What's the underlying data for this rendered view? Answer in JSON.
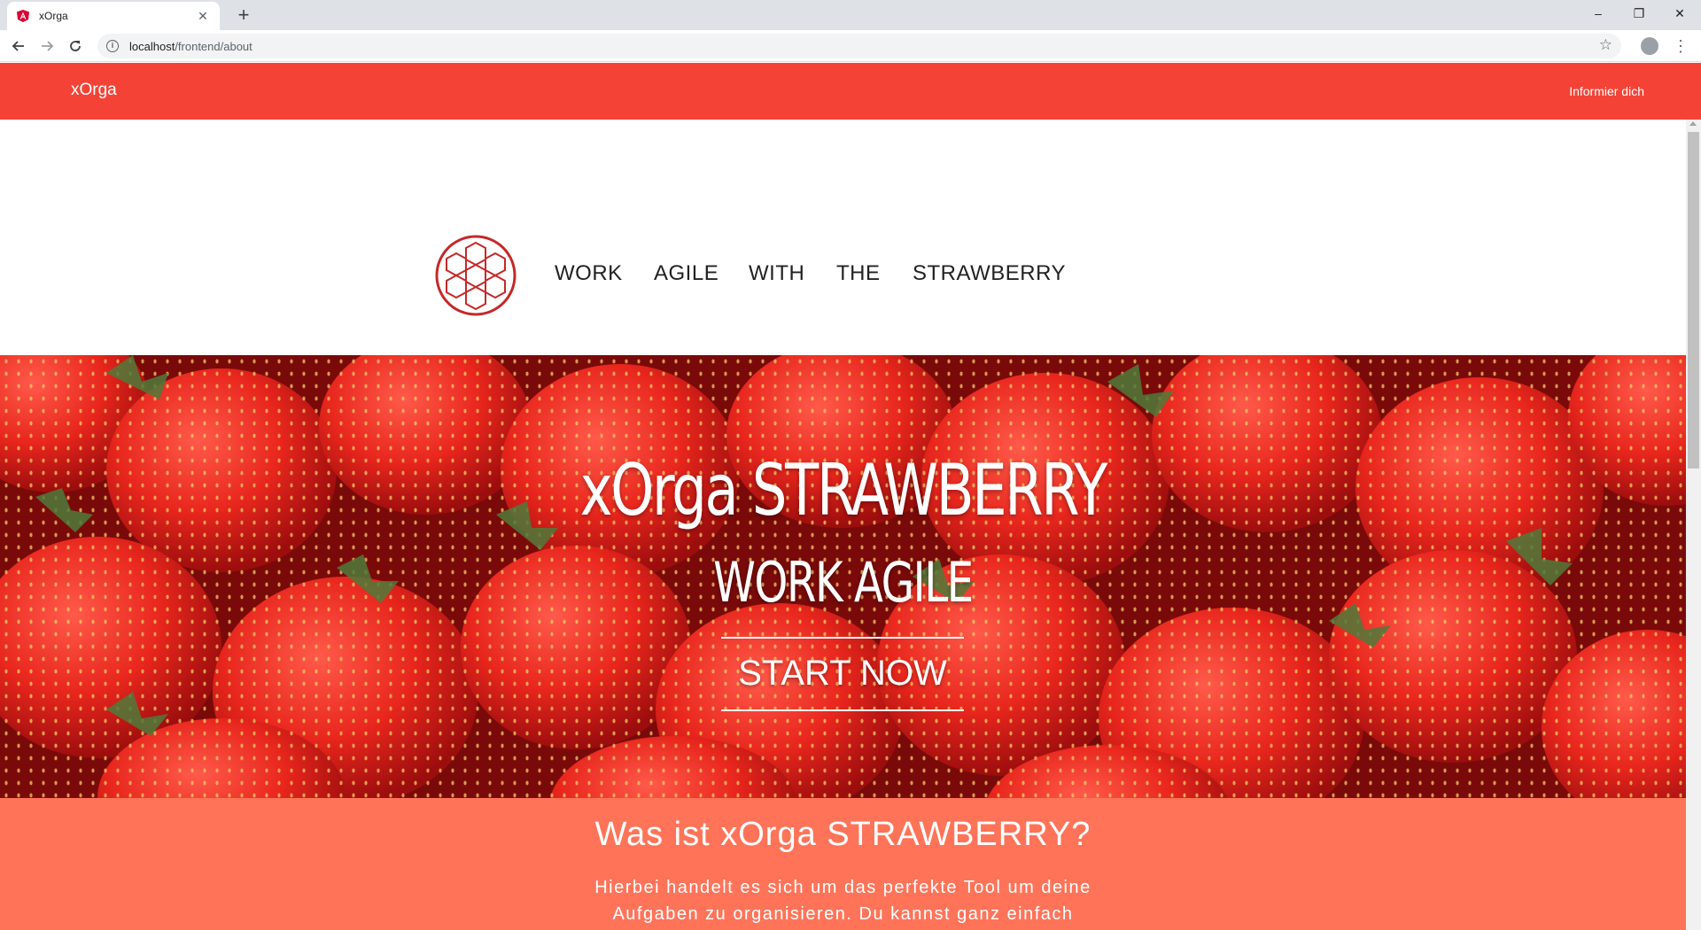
{
  "browser": {
    "tab_title": "xOrga",
    "new_tab_symbol": "+",
    "close_tab_symbol": "✕",
    "url_host": "localhost",
    "url_path": "/frontend/about",
    "window_controls": {
      "minimize": "–",
      "restore": "❐",
      "close": "✕"
    }
  },
  "app": {
    "brand": "xOrga",
    "nav_link": "Informier dich",
    "accent_color": "#f44336",
    "section_color": "#ff7459"
  },
  "hero": {
    "words": [
      "WORK",
      "AGILE",
      "WITH",
      "THE",
      "STRAWBERRY"
    ],
    "logo_icon": "strawberry-hexagon-logo"
  },
  "banner": {
    "title": "xOrga STRAWBERRY",
    "subtitle": "WORK AGILE",
    "button_label": "START NOW"
  },
  "info": {
    "title": "Was ist xOrga STRAWBERRY?",
    "text": "Hierbei handelt es sich um das perfekte Tool um deine Aufgaben zu organisieren. Du kannst ganz einfach"
  }
}
